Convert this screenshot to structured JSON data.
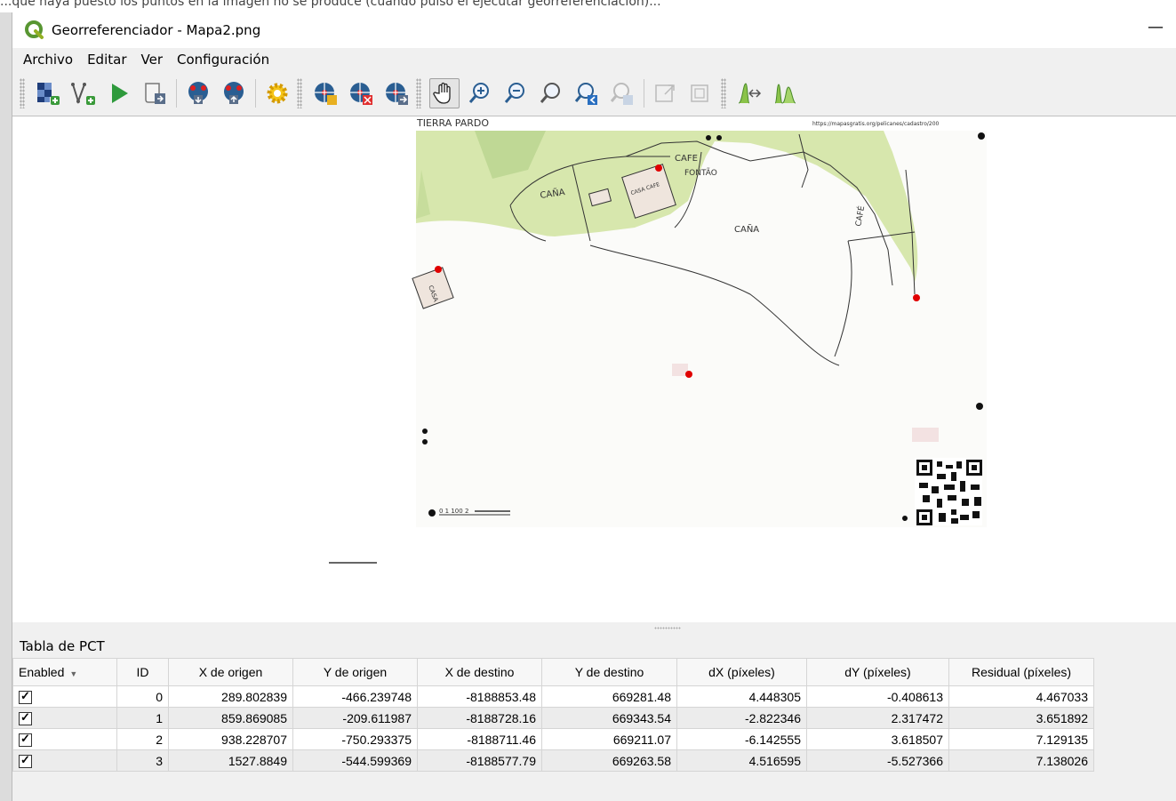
{
  "window": {
    "title": "Georreferenciador - Mapa2.png",
    "minimize_label": "—"
  },
  "menubar": {
    "items": [
      "Archivo",
      "Editar",
      "Ver",
      "Configuración"
    ]
  },
  "toolbar": {
    "buttons": [
      "add-raster-icon",
      "add-point-vector-icon",
      "start-georeferencing-icon",
      "generate-gdal-script-icon",
      "load-gcp-points-icon",
      "save-gcp-points-icon",
      "transformation-settings-icon",
      "add-point-icon",
      "delete-point-icon",
      "move-gcp-point-icon",
      "pan-icon",
      "zoom-in-icon",
      "zoom-out-icon",
      "zoom-to-layer-icon",
      "zoom-last-icon",
      "zoom-next-icon",
      "link-georeferencer-to-qgis-icon",
      "link-qgis-to-georeferencer-icon",
      "full-histogram-stretch-icon",
      "local-histogram-stretch-icon"
    ],
    "active_tool": "pan-icon"
  },
  "map": {
    "colors": {
      "green": "#d6e8a8",
      "dark_green": "#b5d48a",
      "gcp_point": "#e00000"
    },
    "labels": {
      "top_left": "TIERRA  PARDO",
      "top_right": "https://mapasgratis.org/pelicanes/cadastro/200",
      "cafe_label": "CAFE",
      "cafe_sub": "FONTÃO",
      "cana1": "CAÑA",
      "cana2": "CAÑA",
      "casa": "CASA",
      "cafe_vertical": "CAFÉ",
      "house_label": "CASA CAFE",
      "scale_text": "0    1        100  2"
    }
  },
  "pct": {
    "title": "Tabla de PCT",
    "columns": [
      "Enabled",
      "ID",
      "X de origen",
      "Y de origen",
      "X de destino",
      "Y de destino",
      "dX (píxeles)",
      "dY (píxeles)",
      "Residual (píxeles)"
    ],
    "rows": [
      {
        "enabled": true,
        "id": "0",
        "x_origen": "289.802839",
        "y_origen": "-466.239748",
        "x_destino": "-8188853.48",
        "y_destino": "669281.48",
        "dx": "4.448305",
        "dy": "-0.408613",
        "residual": "4.467033"
      },
      {
        "enabled": true,
        "id": "1",
        "x_origen": "859.869085",
        "y_origen": "-209.611987",
        "x_destino": "-8188728.16",
        "y_destino": "669343.54",
        "dx": "-2.822346",
        "dy": "2.317472",
        "residual": "3.651892"
      },
      {
        "enabled": true,
        "id": "2",
        "x_origen": "938.228707",
        "y_origen": "-750.293375",
        "x_destino": "-8188711.46",
        "y_destino": "669211.07",
        "dx": "-6.142555",
        "dy": "3.618507",
        "residual": "7.129135"
      },
      {
        "enabled": true,
        "id": "3",
        "x_origen": "1527.8849",
        "y_origen": "-544.599369",
        "x_destino": "-8188577.79",
        "y_destino": "669263.58",
        "dx": "4.516595",
        "dy": "-5.527366",
        "residual": "7.138026"
      }
    ]
  },
  "partial_top_text": "...que haya puesto los puntos en la imagen no se produce (cuando pulso el ejecutar georreferenciación)..."
}
